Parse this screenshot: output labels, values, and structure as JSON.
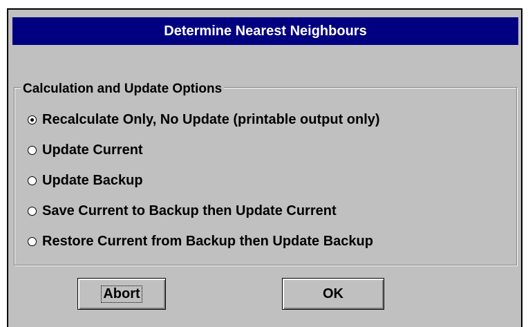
{
  "dialog": {
    "title": "Determine Nearest Neighbours",
    "group_label": "Calculation and Update Options",
    "options": [
      {
        "label": "Recalculate Only, No Update (printable output only)",
        "selected": true
      },
      {
        "label": "Update Current",
        "selected": false
      },
      {
        "label": "Update Backup",
        "selected": false
      },
      {
        "label": "Save Current to Backup then Update Current",
        "selected": false
      },
      {
        "label": "Restore Current from Backup then Update Backup",
        "selected": false
      }
    ],
    "buttons": {
      "abort_label": "Abort",
      "ok_label": "OK"
    }
  },
  "colors": {
    "title_bar": "#000080",
    "dialog_face": "#c0c0c0",
    "title_text": "#ffffff"
  }
}
